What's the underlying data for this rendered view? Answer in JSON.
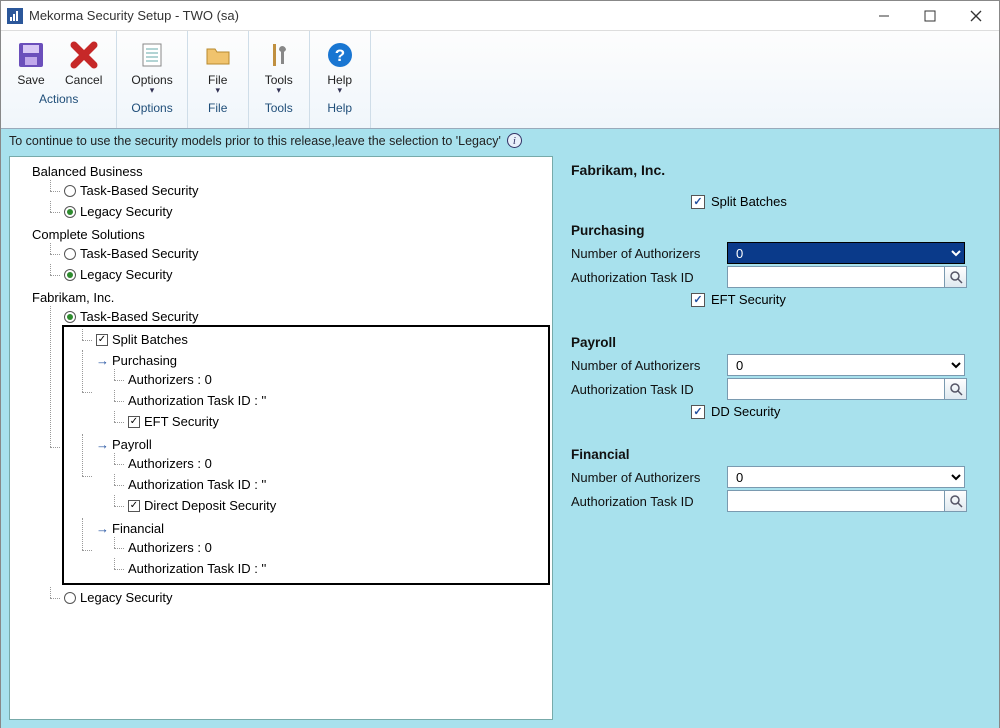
{
  "window": {
    "title": "Mekorma Security Setup  -  TWO (sa)"
  },
  "ribbon": {
    "save": "Save",
    "cancel": "Cancel",
    "options": "Options",
    "file": "File",
    "tools": "Tools",
    "help": "Help",
    "group_actions": "Actions",
    "group_options": "Options",
    "group_file": "File",
    "group_tools": "Tools",
    "group_help": "Help"
  },
  "infostrip": "To continue to use the security models prior to this release,leave the selection to 'Legacy'",
  "tree": {
    "balanced": "Balanced Business",
    "task_based": "Task-Based Security",
    "legacy": "Legacy Security",
    "complete": "Complete Solutions",
    "fabrikam": "Fabrikam, Inc.",
    "split_batches": "Split Batches",
    "purchasing": "Purchasing",
    "authorizers0": "Authorizers : 0",
    "auth_task_empty": "Authorization Task ID : ''",
    "eft_security": "EFT Security",
    "payroll": "Payroll",
    "dd_security": "Direct Deposit Security",
    "financial": "Financial"
  },
  "right": {
    "company": "Fabrikam, Inc.",
    "split_batches": "Split Batches",
    "purchasing": {
      "heading": "Purchasing",
      "num_authorizers_label": "Number of Authorizers",
      "num_authorizers_value": "0",
      "auth_task_label": "Authorization Task ID",
      "auth_task_value": "",
      "eft_security": "EFT Security"
    },
    "payroll": {
      "heading": "Payroll",
      "num_authorizers_label": "Number of Authorizers",
      "num_authorizers_value": "0",
      "auth_task_label": "Authorization Task ID",
      "auth_task_value": "",
      "dd_security": "DD Security"
    },
    "financial": {
      "heading": "Financial",
      "num_authorizers_label": "Number of Authorizers",
      "num_authorizers_value": "0",
      "auth_task_label": "Authorization Task ID",
      "auth_task_value": ""
    }
  }
}
